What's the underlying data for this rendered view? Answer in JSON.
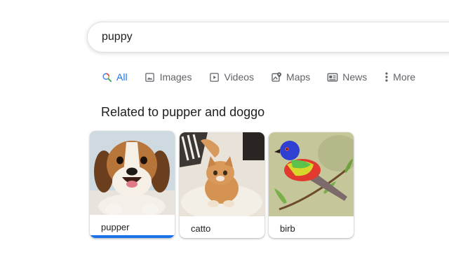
{
  "search": {
    "query": "puppy"
  },
  "tabs": [
    {
      "label": "All",
      "icon": "search-icon",
      "active": true
    },
    {
      "label": "Images",
      "icon": "image-icon",
      "active": false
    },
    {
      "label": "Videos",
      "icon": "video-icon",
      "active": false
    },
    {
      "label": "Maps",
      "icon": "map-icon",
      "active": false
    },
    {
      "label": "News",
      "icon": "news-icon",
      "active": false
    },
    {
      "label": "More",
      "icon": "more-vert-icon",
      "active": false
    }
  ],
  "related": {
    "title": "Related to pupper and doggo",
    "cards": [
      {
        "label": "pupper",
        "image": "beagle puppy photo",
        "selected": true
      },
      {
        "label": "catto",
        "image": "kitten photo",
        "selected": false
      },
      {
        "label": "birb",
        "image": "painted bunting bird photo",
        "selected": false
      }
    ]
  },
  "colors": {
    "accent": "#1a73e8",
    "text": "#202124",
    "muted": "#5f6368"
  }
}
